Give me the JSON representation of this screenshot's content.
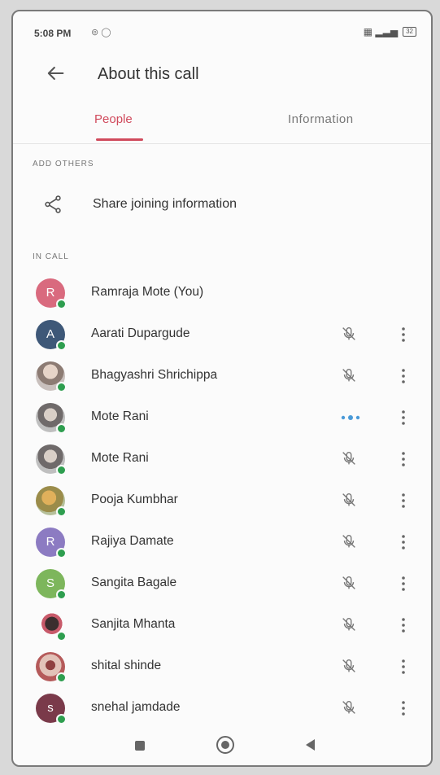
{
  "status_bar": {
    "time": "5:08 PM",
    "battery": "32"
  },
  "app_bar": {
    "title": "About this call"
  },
  "tabs": [
    {
      "label": "People",
      "selected": true
    },
    {
      "label": "Information",
      "selected": false
    }
  ],
  "sections": {
    "add_others": "ADD OTHERS",
    "in_call": "IN CALL"
  },
  "share": {
    "label": "Share joining information",
    "icon": "share-icon"
  },
  "participants": [
    {
      "name": "Ramraja Mote (You)",
      "avatar_letter": "R",
      "avatar_color": "#d96a7e",
      "state": "self"
    },
    {
      "name": "Aarati Dupargude",
      "avatar_letter": "A",
      "avatar_color": "#3e5878",
      "state": "muted"
    },
    {
      "name": "Bhagyashri Shrichippa",
      "avatar_letter": "",
      "avatar_color": "photo",
      "state": "muted"
    },
    {
      "name": "Mote Rani",
      "avatar_letter": "",
      "avatar_color": "photo2",
      "state": "speaking"
    },
    {
      "name": "Mote Rani",
      "avatar_letter": "",
      "avatar_color": "photo2",
      "state": "muted"
    },
    {
      "name": "Pooja Kumbhar",
      "avatar_letter": "",
      "avatar_color": "photo3",
      "state": "muted"
    },
    {
      "name": "Rajiya Damate",
      "avatar_letter": "R",
      "avatar_color": "#8c7bc2",
      "state": "muted"
    },
    {
      "name": "Sangita Bagale",
      "avatar_letter": "S",
      "avatar_color": "#7db65c",
      "state": "muted"
    },
    {
      "name": "Sanjita Mhanta",
      "avatar_letter": "",
      "avatar_color": "photo4",
      "state": "muted"
    },
    {
      "name": "shital shinde",
      "avatar_letter": "",
      "avatar_color": "photo5",
      "state": "muted"
    },
    {
      "name": "snehal jamdade",
      "avatar_letter": "s",
      "avatar_color": "#7a3a4a",
      "state": "muted"
    }
  ],
  "colors": {
    "accent": "#d04a5c",
    "online_dot": "#2e9e4f",
    "speaking": "#4a9ad8"
  }
}
